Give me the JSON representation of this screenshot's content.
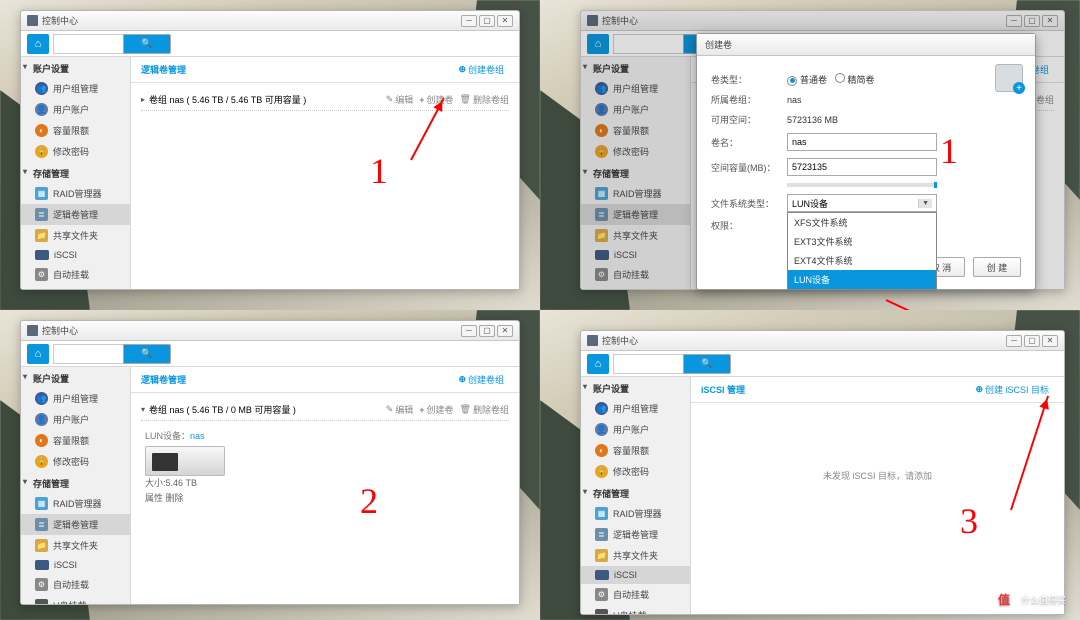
{
  "window_title": "控制中心",
  "sidebar": {
    "group_account": "账户设置",
    "group_storage": "存储管理",
    "items": {
      "user_group": "用户组管理",
      "user": "用户账户",
      "quota": "容量限额",
      "pwd": "修改密码",
      "raid": "RAID管理器",
      "vol": "逻辑卷管理",
      "share": "共享文件夹",
      "iscsi": "iSCSI",
      "mount": "自动挂载",
      "usb": "U盘挂载"
    }
  },
  "panel1": {
    "title": "逻辑卷管理",
    "create_group": "创建卷组",
    "vol_line": "卷组 nas ( 5.46 TB / 5.46 TB 可用容量 )",
    "edit": "编辑",
    "create_vol": "创建卷",
    "del": "删除卷组"
  },
  "panel3": {
    "title": "逻辑卷管理",
    "create_group": "创建卷组",
    "vol_line": "卷组 nas ( 5.46 TB / 0 MB 可用容量 )",
    "edit": "编辑",
    "create_vol": "创建卷",
    "del": "删除卷组",
    "lun_label": "LUN设备：",
    "lun_name": "nas",
    "size_label": "大小:5.46 TB",
    "ops": "属性   删除"
  },
  "panel4": {
    "title": "iSCSI 管理",
    "create": "创建 iSCSI 目标",
    "empty": "未发现 iSCSI 目标，请添加"
  },
  "modal": {
    "title": "创建卷",
    "type_label": "卷类型：",
    "type_normal": "普通卷",
    "type_thin": "精简卷",
    "vg_label": "所属卷组：",
    "vg_val": "nas",
    "avail_label": "可用空间：",
    "avail_val": "5723136 MB",
    "name_label": "卷名：",
    "name_val": "nas",
    "size_label": "空间容量(MB)：",
    "size_val": "5723135",
    "fs_label": "文件系统类型：",
    "fs_sel": "LUN设备",
    "fs_opts": [
      "XFS文件系统",
      "EXT3文件系统",
      "EXT4文件系统",
      "LUN设备"
    ],
    "perm_label": "权限：",
    "cancel": "取 消",
    "ok": "创 建"
  },
  "annot": {
    "n1": "1",
    "n2": "2",
    "n3": "3"
  },
  "watermark": "什么值得买"
}
